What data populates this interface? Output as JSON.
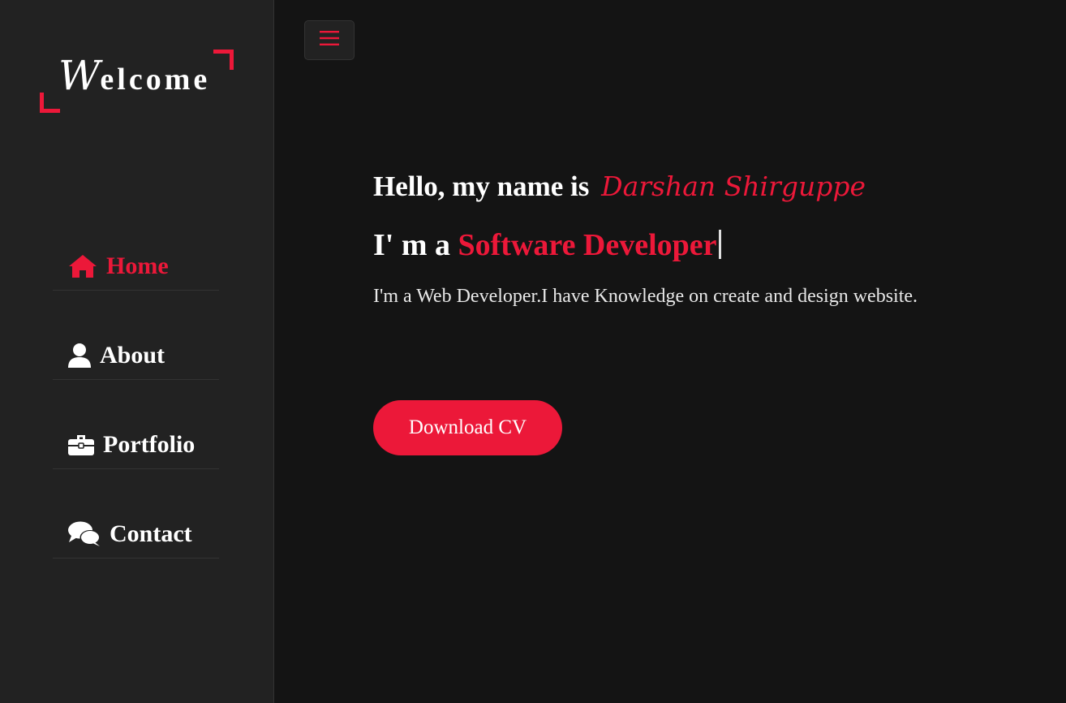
{
  "logo": {
    "first_letter": "W",
    "rest": "elcome"
  },
  "nav": {
    "items": [
      {
        "label": "Home",
        "icon": "home-icon",
        "active": true
      },
      {
        "label": "About",
        "icon": "user-icon",
        "active": false
      },
      {
        "label": "Portfolio",
        "icon": "briefcase-icon",
        "active": false
      },
      {
        "label": "Contact",
        "icon": "comments-icon",
        "active": false
      }
    ]
  },
  "header": {
    "menu_icon": "hamburger-icon"
  },
  "hero": {
    "greeting": "Hello, my name is",
    "name": "Darshan Shirguppe",
    "role_prefix": "I' m a",
    "role_typed": "Software Developer",
    "description": "I'm a Web Developer.I have Knowledge on create and design website.",
    "cta_label": "Download CV"
  },
  "colors": {
    "accent": "#ec1839",
    "sidebar_bg": "#222222",
    "page_bg": "#141414",
    "text": "#ffffff"
  }
}
